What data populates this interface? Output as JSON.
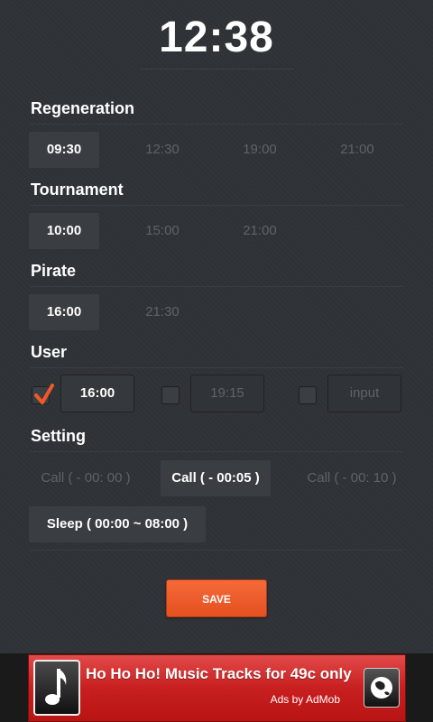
{
  "clock": "12:38",
  "sections": {
    "regeneration": {
      "title": "Regeneration",
      "times": [
        "09:30",
        "12:30",
        "19:00",
        "21:00"
      ],
      "active_index": 0
    },
    "tournament": {
      "title": "Tournament",
      "times": [
        "10:00",
        "15:00",
        "21:00"
      ],
      "active_index": 0
    },
    "pirate": {
      "title": "Pirate",
      "times": [
        "16:00",
        "21:30"
      ],
      "active_index": 0
    },
    "user": {
      "title": "User",
      "entries": [
        {
          "checked": true,
          "value": "16:00"
        },
        {
          "checked": false,
          "value": "19:15"
        },
        {
          "checked": false,
          "placeholder": "input"
        }
      ]
    },
    "setting": {
      "title": "Setting",
      "calls": [
        "Call (  - 00: 00 )",
        "Call ( - 00:05 )",
        "Call (  - 00: 10 )"
      ],
      "active_call_index": 1,
      "sleep": "Sleep ( 00:00 ~ 08:00 )"
    }
  },
  "save_label": "SAVE",
  "ad": {
    "title": "Ho Ho Ho! Music Tracks for 49c only",
    "subtitle": "Ads by AdMob"
  },
  "colors": {
    "background": "#2f3236",
    "accent": "#e5501f",
    "check": "#f0582a",
    "ad_red": "#c81f1f"
  }
}
